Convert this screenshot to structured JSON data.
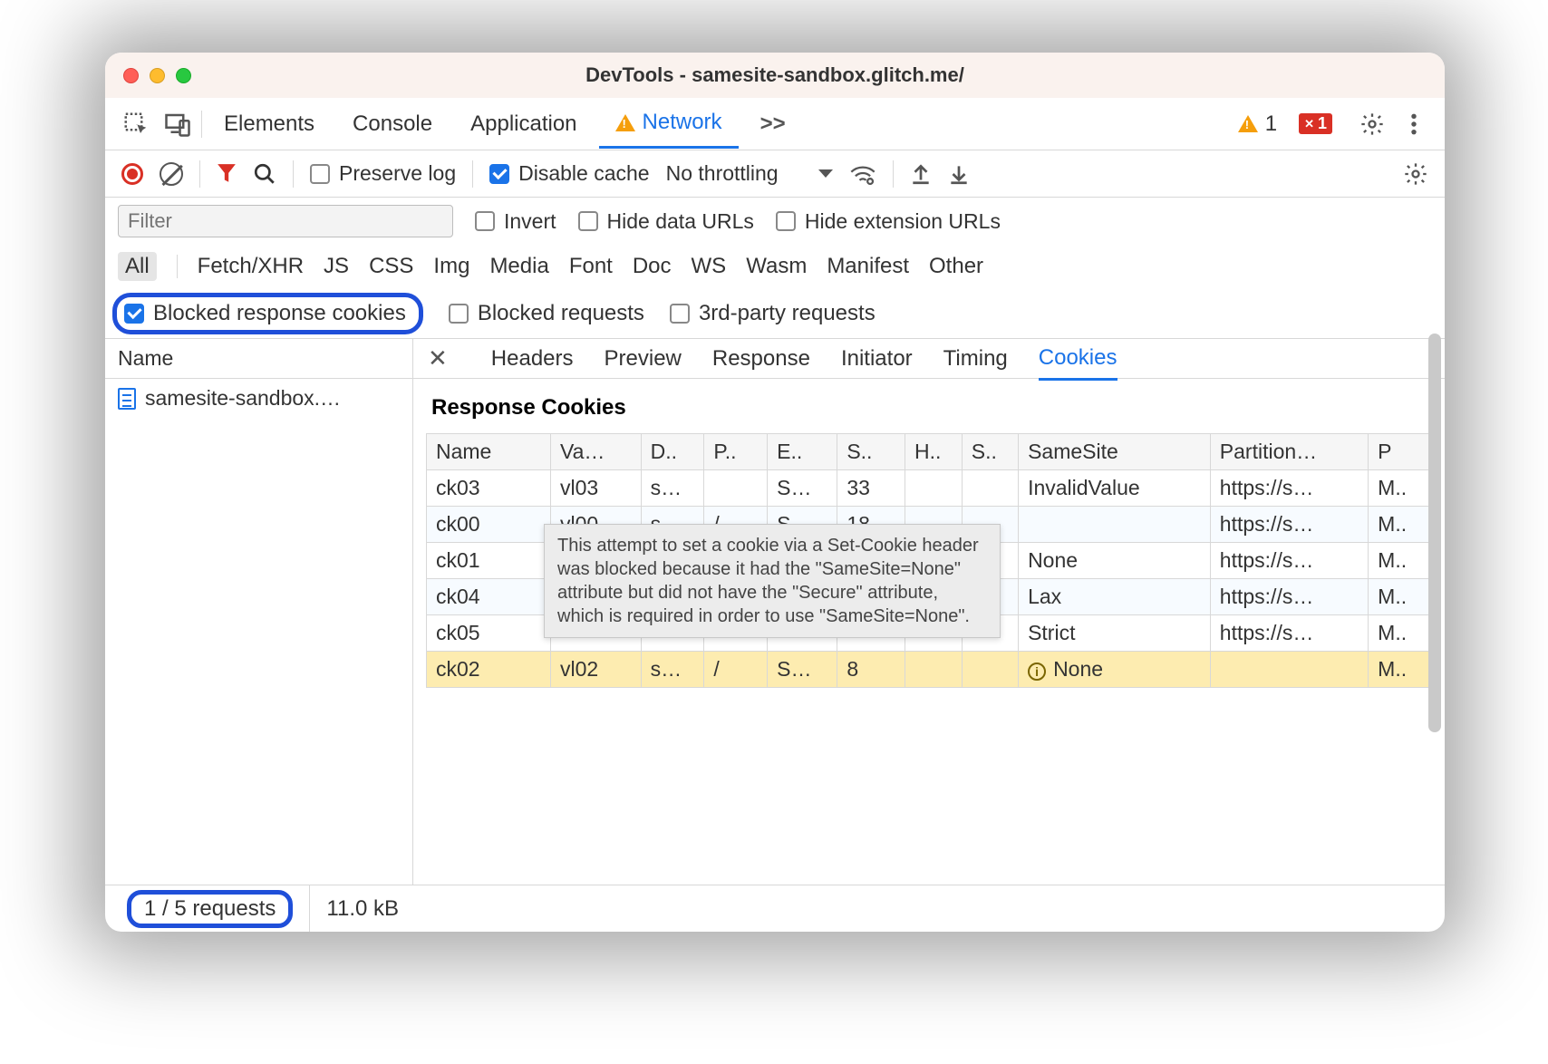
{
  "window": {
    "title": "DevTools - samesite-sandbox.glitch.me/"
  },
  "mainTabs": {
    "items": [
      "Elements",
      "Console",
      "Application",
      "Network"
    ],
    "active": "Network",
    "more": ">>",
    "warnCount": "1",
    "errCount": "1"
  },
  "toolbar": {
    "preserveLog": "Preserve log",
    "disableCache": "Disable cache",
    "throttling": "No throttling"
  },
  "filterRow": {
    "placeholder": "Filter",
    "invert": "Invert",
    "hideData": "Hide data URLs",
    "hideExt": "Hide extension URLs"
  },
  "typeRow": {
    "all": "All",
    "types": [
      "Fetch/XHR",
      "JS",
      "CSS",
      "Img",
      "Media",
      "Font",
      "Doc",
      "WS",
      "Wasm",
      "Manifest",
      "Other"
    ]
  },
  "optRow": {
    "blockedCookies": "Blocked response cookies",
    "blockedReq": "Blocked requests",
    "thirdParty": "3rd-party requests"
  },
  "requestList": {
    "header": "Name",
    "items": [
      "samesite-sandbox.…"
    ]
  },
  "detailTabs": {
    "items": [
      "Headers",
      "Preview",
      "Response",
      "Initiator",
      "Timing",
      "Cookies"
    ],
    "active": "Cookies"
  },
  "cookiePane": {
    "title": "Response Cookies",
    "columns": [
      "Name",
      "Va…",
      "D..",
      "P..",
      "E..",
      "S..",
      "H..",
      "S..",
      "SameSite",
      "Partition…",
      "P"
    ],
    "rows": [
      {
        "c": [
          "ck03",
          "vl03",
          "s…",
          "",
          "S…",
          "33",
          "",
          "",
          "InvalidValue",
          "https://s…",
          "M.."
        ],
        "hl": false
      },
      {
        "c": [
          "ck00",
          "vl00",
          "s…",
          "/",
          "S…",
          "18",
          "",
          "",
          "",
          "https://s…",
          "M.."
        ],
        "hl": false
      },
      {
        "c": [
          "ck01",
          "",
          "",
          "",
          "",
          "",
          "",
          "",
          "None",
          "https://s…",
          "M.."
        ],
        "hl": false
      },
      {
        "c": [
          "ck04",
          "",
          "",
          "",
          "",
          "",
          "",
          "",
          "Lax",
          "https://s…",
          "M.."
        ],
        "hl": false
      },
      {
        "c": [
          "ck05",
          "",
          "",
          "",
          "",
          "",
          "",
          "",
          "Strict",
          "https://s…",
          "M.."
        ],
        "hl": false
      },
      {
        "c": [
          "ck02",
          "vl02",
          "s…",
          "/",
          "S…",
          "8",
          "",
          "",
          "None",
          "",
          "M.."
        ],
        "hl": true,
        "info": true
      }
    ]
  },
  "tooltip": "This attempt to set a cookie via a Set-Cookie header was blocked because it had the \"SameSite=None\" attribute but did not have the \"Secure\" attribute, which is required in order to use \"SameSite=None\".",
  "statusBar": {
    "requests": "1 / 5 requests",
    "transfer": "11.0 kB"
  },
  "colors": {
    "accent": "#1a73e8",
    "warn": "#f59e0b",
    "err": "#d93025",
    "highlightRow": "#fdecb0",
    "ring": "#1f4fd9"
  }
}
